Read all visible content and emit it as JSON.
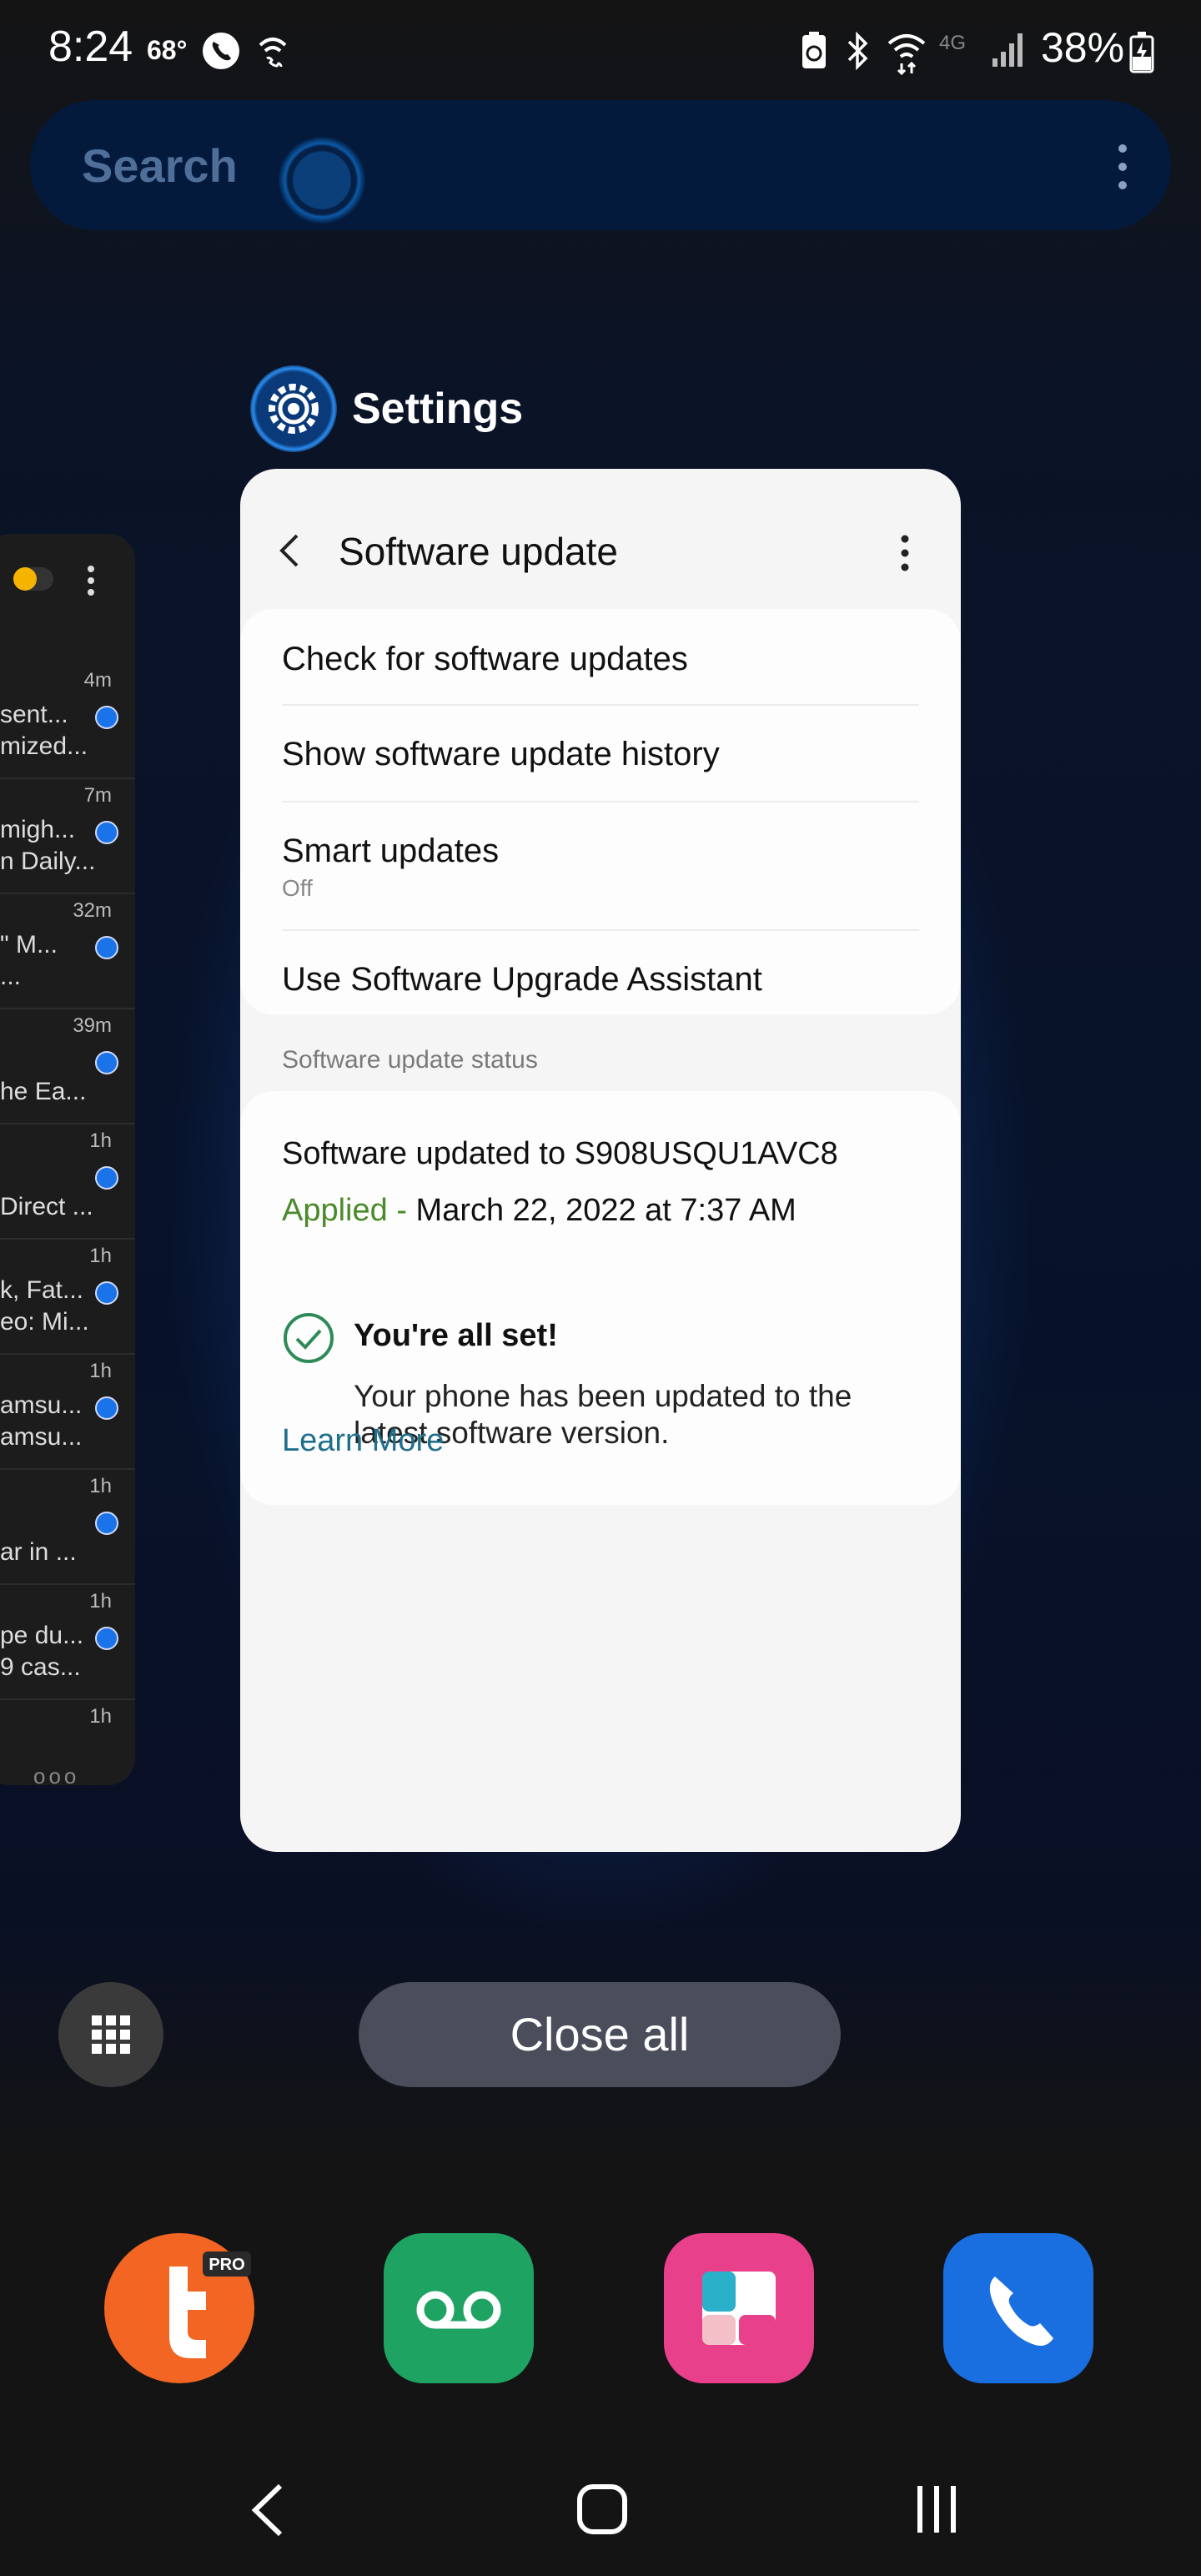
{
  "status_bar": {
    "time": "8:24",
    "temperature": "68°",
    "network": "4G",
    "battery": "38%",
    "icons": [
      "phone-call-icon",
      "wifi-calling-icon",
      "battery-saver-icon",
      "bluetooth-icon",
      "wifi-icon",
      "signal-icon",
      "battery-charging-icon"
    ]
  },
  "search": {
    "placeholder": "Search",
    "menu_icon": "more-vertical-icon"
  },
  "recent_app": {
    "app_name": "Settings",
    "app_icon": "settings-gear-icon",
    "screen": {
      "title": "Software update",
      "back_icon": "chevron-left-icon",
      "menu_icon": "more-vertical-icon",
      "menu_items": [
        {
          "label": "Check for software updates"
        },
        {
          "label": "Show software update history"
        },
        {
          "label": "Smart updates",
          "sub": "Off"
        },
        {
          "label": "Use Software Upgrade Assistant"
        }
      ],
      "status_section": {
        "header": "Software update status",
        "version_line": "Software updated to S908USQU1AVC8",
        "applied_label": "Applied -",
        "applied_date": "March 22, 2022 at 7:37 AM",
        "allset_title": "You're all set!",
        "allset_desc": "Your phone has been updated to the latest software version.",
        "learn_more": "Learn More"
      }
    }
  },
  "left_app_preview": {
    "items": [
      {
        "time": "4m",
        "line1": "sent...",
        "line2": "mized..."
      },
      {
        "time": "7m",
        "line1": "migh...",
        "line2": "n Daily..."
      },
      {
        "time": "32m",
        "line1": "\" M...",
        "line2": "..."
      },
      {
        "time": "39m",
        "line1": "",
        "line2": "he Ea..."
      },
      {
        "time": "1h",
        "line1": "",
        "line2": "Direct ..."
      },
      {
        "time": "1h",
        "line1": "k, Fat...",
        "line2": "eo: Mi..."
      },
      {
        "time": "1h",
        "line1": "amsu...",
        "line2": "amsu..."
      },
      {
        "time": "1h",
        "line1": "",
        "line2": "ar in ..."
      },
      {
        "time": "1h",
        "line1": "pe du...",
        "line2": "9 cas..."
      },
      {
        "time": "1h",
        "line1": "",
        "line2": ""
      }
    ],
    "more_indicator": "ooo"
  },
  "controls": {
    "close_all": "Close all",
    "grid_icon": "app-grid-icon"
  },
  "dock": {
    "apps": [
      {
        "name": "tapatalk-pro-icon",
        "badge": "PRO",
        "color": "#f26522"
      },
      {
        "name": "voicemail-icon",
        "color": "#1ea362"
      },
      {
        "name": "galaxy-store-icon",
        "color": "#e8408a"
      },
      {
        "name": "phone-icon",
        "color": "#1a6fe0"
      }
    ]
  },
  "navbar": {
    "back": "back-icon",
    "home": "home-icon",
    "recents": "recents-icon"
  }
}
